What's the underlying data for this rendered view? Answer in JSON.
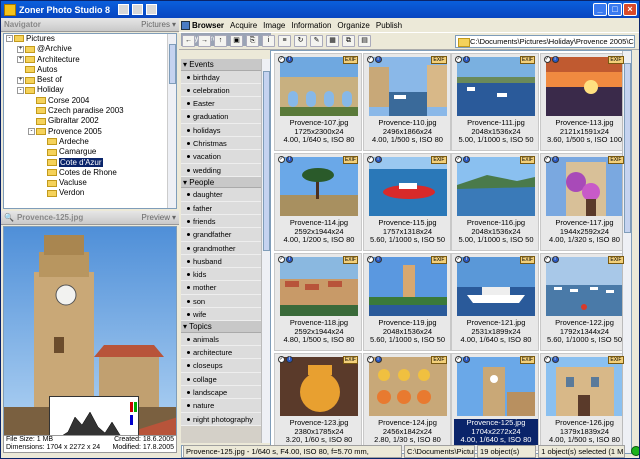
{
  "window": {
    "title": "Zoner Photo Studio 8"
  },
  "navigator": {
    "title": "Navigator",
    "dropdown": "Pictures",
    "tree": [
      {
        "label": "Pictures",
        "level": 0,
        "toggle": "-"
      },
      {
        "label": "@Archive",
        "level": 1,
        "toggle": "+"
      },
      {
        "label": "Architecture",
        "level": 1,
        "toggle": "+"
      },
      {
        "label": "Autos",
        "level": 1,
        "toggle": ""
      },
      {
        "label": "Best of",
        "level": 1,
        "toggle": "+"
      },
      {
        "label": "Holiday",
        "level": 1,
        "toggle": "-"
      },
      {
        "label": "Corse 2004",
        "level": 2,
        "toggle": ""
      },
      {
        "label": "Czech paradise 2003",
        "level": 2,
        "toggle": ""
      },
      {
        "label": "Gibraltar 2002",
        "level": 2,
        "toggle": ""
      },
      {
        "label": "Provence 2005",
        "level": 2,
        "toggle": "-"
      },
      {
        "label": "Ardeche",
        "level": 3,
        "toggle": ""
      },
      {
        "label": "Camargue",
        "level": 3,
        "toggle": ""
      },
      {
        "label": "Cote d'Azur",
        "level": 3,
        "toggle": "",
        "selected": true
      },
      {
        "label": "Cotes de Rhone",
        "level": 3,
        "toggle": ""
      },
      {
        "label": "Vacluse",
        "level": 3,
        "toggle": ""
      },
      {
        "label": "Verdon",
        "level": 3,
        "toggle": ""
      }
    ]
  },
  "preview": {
    "filename": "Provence-125.jpg",
    "dropdown": "Preview",
    "file_size": "File Size: 1 MB",
    "created": "Created: 18.6.2005",
    "dimensions": "Dimensions: 1704 x 2272 x 24",
    "modified": "Modified: 17.8.2005"
  },
  "keywords": {
    "title": "Keywords",
    "groups": [
      {
        "name": "Events",
        "items": [
          "birthday",
          "celebration",
          "Easter",
          "graduation",
          "holidays",
          "Christmas",
          "vacation",
          "wedding"
        ]
      },
      {
        "name": "People",
        "items": [
          "daughter",
          "father",
          "friends",
          "grandfather",
          "grandmother",
          "husband",
          "kids",
          "mother",
          "son",
          "wife"
        ]
      },
      {
        "name": "Topics",
        "items": [
          "animals",
          "architecture",
          "closeups",
          "collage",
          "landscape",
          "nature",
          "night photography"
        ]
      }
    ]
  },
  "menu": {
    "browser": "Browser",
    "items": [
      "Acquire",
      "Image",
      "Information",
      "Organize",
      "Publish"
    ]
  },
  "path": "C:\\Documents\\Pictures\\Holiday\\Provence 2005\\Co",
  "thumbnails": [
    {
      "name": "Provence-107.jpg",
      "dims": "1725x2300x24",
      "exif": "4.00, 1/640 s, ISO 80",
      "scene": "aqueduct"
    },
    {
      "name": "Provence-110.jpg",
      "dims": "2496x1866x24",
      "exif": "4.00, 1/500 s, ISO 80",
      "scene": "canal"
    },
    {
      "name": "Provence-111.jpg",
      "dims": "2048x1536x24",
      "exif": "5.00, 1/1000 s, ISO 50",
      "scene": "harbor"
    },
    {
      "name": "Provence-113.jpg",
      "dims": "2121x1591x24",
      "exif": "3.60, 1/500 s, ISO 100",
      "scene": "sunset"
    },
    {
      "name": "Provence-114.jpg",
      "dims": "2592x1944x24",
      "exif": "4.00, 1/200 s, ISO 80",
      "scene": "pine"
    },
    {
      "name": "Provence-115.jpg",
      "dims": "1757x1318x24",
      "exif": "5.60, 1/1000 s, ISO 50",
      "scene": "boat"
    },
    {
      "name": "Provence-116.jpg",
      "dims": "2048x1536x24",
      "exif": "5.00, 1/1000 s, ISO 50",
      "scene": "bay"
    },
    {
      "name": "Provence-117.jpg",
      "dims": "1944x2592x24",
      "exif": "4.00, 1/320 s, ISO 80",
      "scene": "flowers"
    },
    {
      "name": "Provence-118.jpg",
      "dims": "2592x1944x24",
      "exif": "4.80, 1/500 s, ISO 80",
      "scene": "town"
    },
    {
      "name": "Provence-119.jpg",
      "dims": "2048x1536x24",
      "exif": "5.60, 1/1000 s, ISO 50",
      "scene": "tower"
    },
    {
      "name": "Provence-121.jpg",
      "dims": "2531x1899x24",
      "exif": "4.00, 1/640 s, ISO 80",
      "scene": "yacht"
    },
    {
      "name": "Provence-122.jpg",
      "dims": "1792x1344x24",
      "exif": "5.60, 1/1000 s, ISO 50",
      "scene": "marina"
    },
    {
      "name": "Provence-123.jpg",
      "dims": "2380x1785x24",
      "exif": "3.20, 1/60 s, ISO 80",
      "scene": "pitcher"
    },
    {
      "name": "Provence-124.jpg",
      "dims": "2456x1842x24",
      "exif": "2.80, 1/30 s, ISO 80",
      "scene": "pottery"
    },
    {
      "name": "Provence-125.jpg",
      "dims": "1704x2272x24",
      "exif": "4.00, 1/640 s, ISO 80",
      "scene": "clocktower",
      "selected": true
    },
    {
      "name": "Provence-126.jpg",
      "dims": "1379x1839x24",
      "exif": "4.00, 1/500 s, ISO 80",
      "scene": "house"
    }
  ],
  "status": {
    "info": "Provence-125.jpg - 1/640 s, F4.00, ISO 80, f=5.70 mm,",
    "path": "C:\\Documents\\Pictures\\Holiday...",
    "count": "19 object(s)",
    "selection": "1 object(s) selected (1 MB)"
  }
}
